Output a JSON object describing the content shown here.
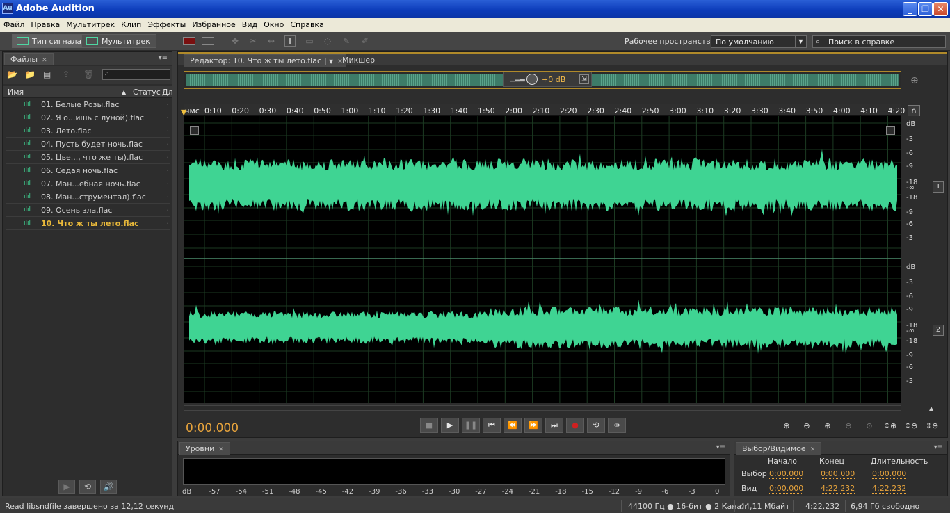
{
  "app": {
    "title": "Adobe Audition",
    "icon_text": "Au"
  },
  "menu": [
    "Файл",
    "Правка",
    "Мультитрек",
    "Клип",
    "Эффекты",
    "Избранное",
    "Вид",
    "Окно",
    "Справка"
  ],
  "toolbar": {
    "waveform_label": "Тип сигнала",
    "multitrack_label": "Мультитрек",
    "workspace_label": "Рабочее пространство:",
    "workspace_value": "По умолчанию",
    "help_search_placeholder": "Поиск в справке"
  },
  "files_panel": {
    "tab": "Файлы",
    "col_name": "Имя",
    "col_status": "Статус",
    "col_dur": "Дл",
    "files": [
      "01. Белые Розы.flac",
      "02. Я о...ишь с луной).flac",
      "03. Лето.flac",
      "04. Пусть будет ночь.flac",
      "05. Цве..., что же ты).flac",
      "06. Седая ночь.flac",
      "07. Ман...ебная ночь.flac",
      "08. Ман...струментал).flac",
      "09. Осень зла.flac",
      "10. Что ж ты лето.flac"
    ],
    "active_index": 9
  },
  "editor": {
    "tab": "Редактор: 10. Что ж ты лето.flac",
    "mixer_tab": "Микшер",
    "hud_gain": "+0 dB",
    "ruler_unit": "чмс",
    "ruler": [
      "0:10",
      "0:20",
      "0:30",
      "0:40",
      "0:50",
      "1:00",
      "1:10",
      "1:20",
      "1:30",
      "1:40",
      "1:50",
      "2:00",
      "2:10",
      "2:20",
      "2:30",
      "2:40",
      "2:50",
      "3:00",
      "3:10",
      "3:20",
      "3:30",
      "3:40",
      "3:50",
      "4:00",
      "4:10",
      "4:20"
    ],
    "db_labels": [
      "dB",
      "-3",
      "-6",
      "-9",
      "-18",
      "-∞",
      "-18",
      "-9",
      "-6",
      "-3"
    ],
    "channels": [
      "1",
      "2"
    ],
    "timecode": "0:00.000",
    "wave_color": "#3fd493"
  },
  "levels": {
    "tab": "Уровни",
    "scale": [
      "dB",
      "-57",
      "-54",
      "-51",
      "-48",
      "-45",
      "-42",
      "-39",
      "-36",
      "-33",
      "-30",
      "-27",
      "-24",
      "-21",
      "-18",
      "-15",
      "-12",
      "-9",
      "-6",
      "-3",
      "0"
    ]
  },
  "selection": {
    "tab": "Выбор/Видимое",
    "headers": [
      "Начало",
      "Конец",
      "Длительность"
    ],
    "rows": [
      {
        "label": "Выбор",
        "start": "0:00.000",
        "end": "0:00.000",
        "dur": "0:00.000"
      },
      {
        "label": "Вид",
        "start": "0:00.000",
        "end": "4:22.232",
        "dur": "4:22.232"
      }
    ]
  },
  "status": {
    "message": "Read libsndfile завершено за 12,12 секунд",
    "format": "44100 Гц ● 16-бит ● 2 Канал",
    "size": "44,11 Мбайт",
    "duration": "4:22.232",
    "free": "6,94 Гб свободно"
  }
}
